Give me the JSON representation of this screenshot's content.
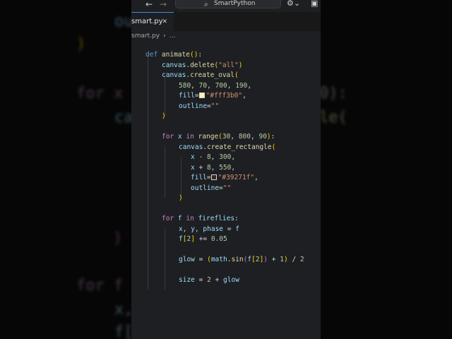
{
  "title_bar": {
    "command_center_label": "SmartPython",
    "back_icon": "arrow-left-icon",
    "forward_icon": "arrow-right-icon",
    "search_icon": "search-icon",
    "copilot_icon": "copilot-icon",
    "layout_icon": "layout-icon"
  },
  "tab": {
    "label": "smart.py",
    "close_glyph": "✕"
  },
  "breadcrumb": [
    "smart.py",
    "›",
    "..."
  ],
  "code_lines": [
    "def animate():",
    "canvas.delete(\"all\")",
    "canvas.create_oval(",
    "580, 70, 700, 190,",
    "fill=\"#fff3b0\",",
    "outline=\"\"",
    ")",
    "",
    "for x in range(30, 800, 90):",
    "canvas.create_rectangle(",
    "x - 8, 300,",
    "x + 8, 550,",
    "fill=\"#39271f\",",
    "outline=\"\"",
    ")",
    "",
    "for f in fireflies:",
    "x, y, phase = f",
    "f[2] += 0.05",
    "",
    "glow = (math.sin(f[2]) + 1) / 2",
    "",
    "size = 2 + glow"
  ],
  "colors": {
    "swatch_oval": "#fff3b0",
    "swatch_rect": "#39271f",
    "editor_bg": "#1e1f22",
    "tab_accent": "#3c8ce6"
  },
  "background_fragments": [
    "ou",
    ")",
    "for x",
    "0):",
    "ca",
    "le(",
    ")",
    "for f",
    "x,",
    "f["
  ]
}
